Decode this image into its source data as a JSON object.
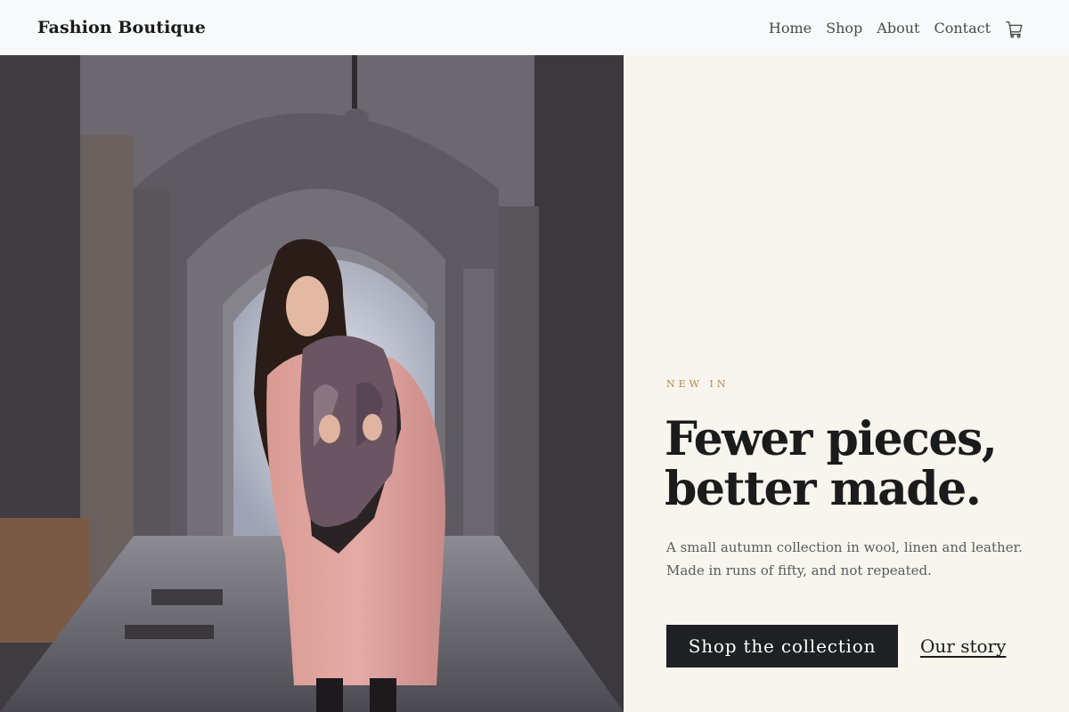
{
  "header": {
    "brand": "Fashion Boutique",
    "nav": [
      "Home",
      "Shop",
      "About",
      "Contact"
    ],
    "cart_icon": "shopping-cart-icon"
  },
  "hero": {
    "image_alt": "Woman in a pink coat and paisley scarf walking under stone arches",
    "eyebrow": "NEW IN",
    "headline_line1": "Fewer pieces,",
    "headline_line2": "better made.",
    "lede": "A small autumn collection in wool, linen and leather. Made in runs of fifty, and not repeated.",
    "primary_cta": "Shop the collection",
    "secondary_cta": "Our story"
  },
  "colors": {
    "header_bg": "#f8f9fb",
    "hero_bg": "#f8f5ef",
    "accent": "#b58a45",
    "button_bg": "#1e2023"
  }
}
